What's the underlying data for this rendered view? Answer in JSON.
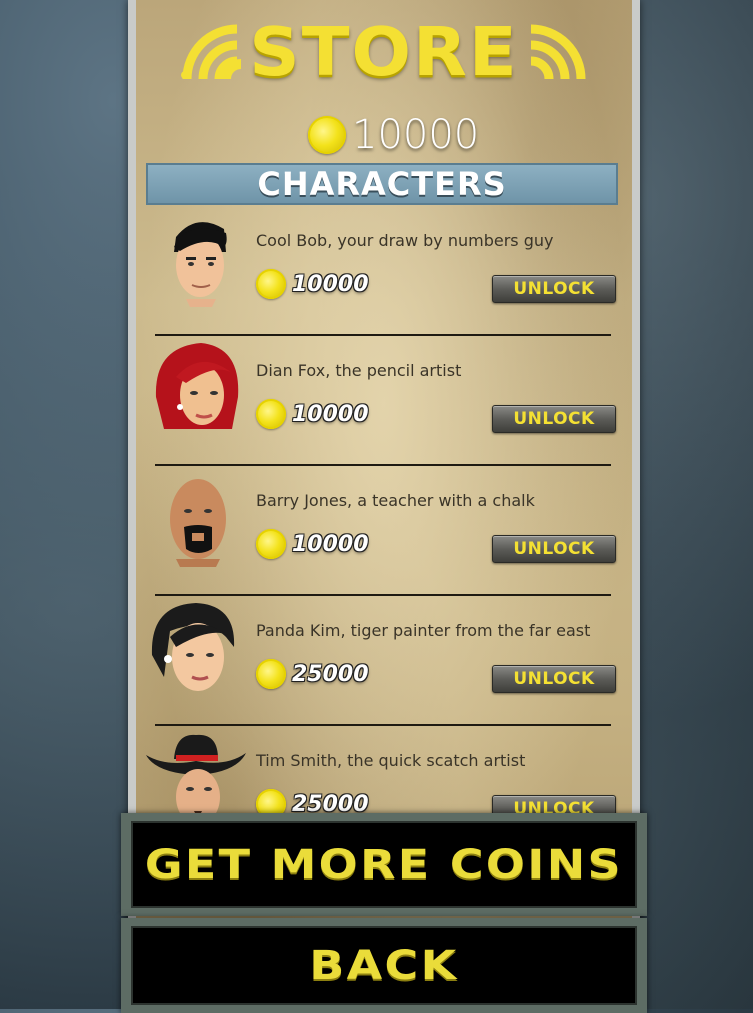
{
  "store": {
    "title": "STORE",
    "coins_total": "10000",
    "section_title": "CHARACTERS"
  },
  "characters": [
    {
      "name": "Cool Bob, your draw by numbers guy",
      "price": "10000",
      "button": "UNLOCK",
      "avatar_icon": "cool-bob-avatar"
    },
    {
      "name": "Dian Fox, the pencil artist",
      "price": "10000",
      "button": "UNLOCK",
      "avatar_icon": "dian-fox-avatar"
    },
    {
      "name": "Barry Jones, a teacher with a chalk",
      "price": "10000",
      "button": "UNLOCK",
      "avatar_icon": "barry-jones-avatar"
    },
    {
      "name": "Panda Kim, tiger painter from the far east",
      "price": "25000",
      "button": "UNLOCK",
      "avatar_icon": "panda-kim-avatar"
    },
    {
      "name": "Tim Smith, the quick scatch artist",
      "price": "25000",
      "button": "UNLOCK",
      "avatar_icon": "tim-smith-avatar"
    }
  ],
  "buttons": {
    "get_more_coins": "GET MORE COINS",
    "back": "BACK"
  },
  "colors": {
    "accent_yellow": "#f4e033",
    "header_blue": "#7fa3b6",
    "parchment": "#c4b081"
  }
}
